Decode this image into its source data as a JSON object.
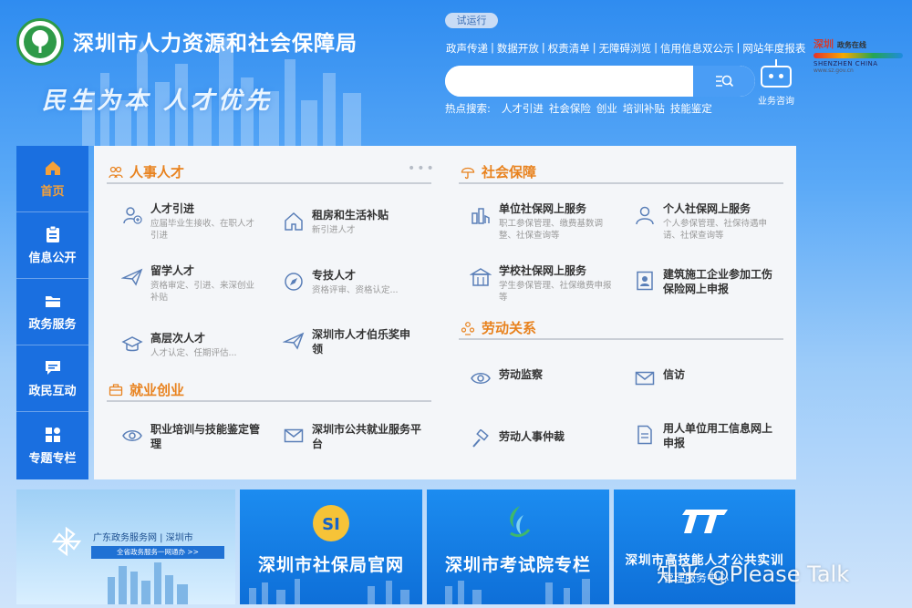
{
  "header": {
    "site_title": "深圳市人力资源和社会保障局",
    "slogan": "民生为本 人才优先",
    "trial_badge": "试运行",
    "top_links": [
      "政声传递",
      "数据开放",
      "权责清单",
      "无障碍浏览",
      "信用信息双公示",
      "网站年度报表"
    ],
    "search": {
      "placeholder": "",
      "value": ""
    },
    "hot_label": "热点搜索:",
    "hot_terms": [
      "人才引进",
      "社会保险",
      "创业",
      "培训补贴",
      "技能鉴定"
    ],
    "robot_label": "业务咨询",
    "city_logo": {
      "calligraphy": "深圳",
      "subtitle": "政务在线",
      "english": "SHENZHEN CHINA",
      "url": "www.sz.gov.cn"
    }
  },
  "sidenav": {
    "items": [
      {
        "label": "首页",
        "icon": "home-icon",
        "active": true
      },
      {
        "label": "信息公开",
        "icon": "clipboard-icon",
        "active": false
      },
      {
        "label": "政务服务",
        "icon": "folder-icon",
        "active": false
      },
      {
        "label": "政民互动",
        "icon": "chat-icon",
        "active": false
      },
      {
        "label": "专题专栏",
        "icon": "grid-icon",
        "active": false
      }
    ]
  },
  "sections": {
    "talent": {
      "title": "人事人才",
      "more": "•••",
      "items": [
        {
          "title": "人才引进",
          "desc": "应届毕业生接收、在职人才引进",
          "icon": "user-add-icon"
        },
        {
          "title": "租房和生活补贴",
          "desc": "新引进人才",
          "icon": "house-icon"
        },
        {
          "title": "留学人才",
          "desc": "资格审定、引进、来深创业补贴",
          "icon": "plane-icon"
        },
        {
          "title": "专技人才",
          "desc": "资格评审、资格认定...",
          "icon": "compass-icon"
        },
        {
          "title": "高层次人才",
          "desc": "人才认定、任期评估...",
          "icon": "graduation-cap-icon"
        },
        {
          "title": "深圳市人才伯乐奖申领",
          "desc": "",
          "icon": "plane-icon"
        }
      ]
    },
    "employment": {
      "title": "就业创业",
      "items": [
        {
          "title": "职业培训与技能鉴定管理",
          "desc": "",
          "icon": "eye-icon"
        },
        {
          "title": "深圳市公共就业服务平台",
          "desc": "",
          "icon": "mail-icon"
        }
      ]
    },
    "social": {
      "title": "社会保障",
      "items": [
        {
          "title": "单位社保网上服务",
          "desc": "职工参保管理、缴费基数调整、社保查询等",
          "icon": "building-chart-icon"
        },
        {
          "title": "个人社保网上服务",
          "desc": "个人参保管理、社保待遇申请、社保查询等",
          "icon": "person-icon"
        },
        {
          "title": "学校社保网上服务",
          "desc": "学生参保管理、社保缴费申报等",
          "icon": "school-icon"
        },
        {
          "title": "建筑施工企业参加工伤保险网上申报",
          "desc": "",
          "icon": "id-card-icon"
        }
      ]
    },
    "labor": {
      "title": "劳动关系",
      "items": [
        {
          "title": "劳动监察",
          "desc": "",
          "icon": "eye-icon"
        },
        {
          "title": "信访",
          "desc": "",
          "icon": "mail-icon"
        },
        {
          "title": "劳动人事仲裁",
          "desc": "",
          "icon": "gavel-icon"
        },
        {
          "title": "用人单位用工信息网上申报",
          "desc": "",
          "icon": "document-icon"
        }
      ]
    }
  },
  "banners": [
    {
      "line1": "广东政务服务网 | 深圳市",
      "line2": "全省政务服务一网通办 >>"
    },
    {
      "title": "深圳市社保局官网",
      "logo": "SI"
    },
    {
      "title": "深圳市考试院专栏"
    },
    {
      "title": "深圳市高技能人才公共实训",
      "sub": "管理服务中心"
    }
  ],
  "watermark": "知乎 @Please Talk",
  "colors": {
    "nav_bg": "#1a6fe0",
    "section_title": "#e8821e",
    "active_nav": "#f4a13a"
  }
}
